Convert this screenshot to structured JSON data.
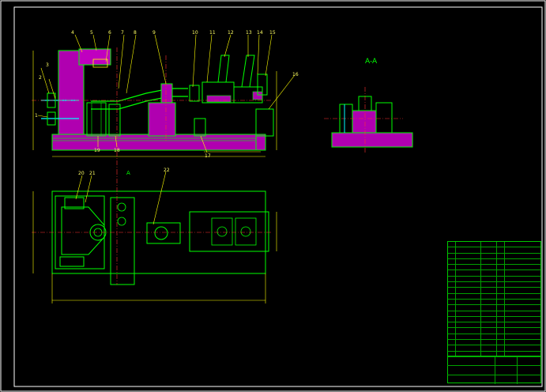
{
  "drawing": {
    "section_label": "A-A",
    "callouts": [
      "1",
      "2",
      "3",
      "4",
      "5",
      "6",
      "7",
      "8",
      "9",
      "10",
      "11",
      "12",
      "13",
      "14",
      "15",
      "16",
      "17",
      "18",
      "19",
      "20",
      "21",
      "22"
    ],
    "view_marker": "A",
    "colors": {
      "background": "#000000",
      "frame": "#ffffff",
      "outline": "#00ff00",
      "hatch": "#ff00ff",
      "dimension": "#ffff00",
      "centerline": "#ff0000",
      "detail": "#00ffff"
    }
  }
}
